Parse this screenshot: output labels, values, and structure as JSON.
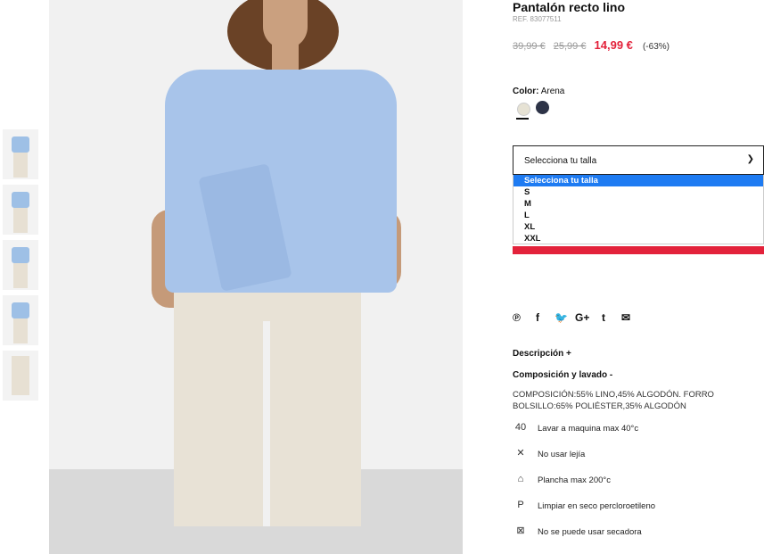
{
  "product": {
    "title": "Pantalón recto lino",
    "ref": "REF. 83077511",
    "price_old_1": "39,99 €",
    "price_old_2": "25,99 €",
    "price_new": "14,99 €",
    "discount": "(-63%)"
  },
  "color": {
    "label": "Color:",
    "value": "Arena",
    "swatches": [
      "#e6e2d4",
      "#2d3347"
    ]
  },
  "size_select": {
    "placeholder": "Selecciona tu talla",
    "options": [
      "Selecciona tu talla",
      "S",
      "M",
      "L",
      "XL",
      "XXL"
    ]
  },
  "social_icons": [
    "pinterest-icon",
    "facebook-icon",
    "twitter-icon",
    "google-plus-icon",
    "tumblr-icon",
    "email-icon"
  ],
  "social_glyphs": [
    "℗",
    "f",
    "🐦",
    "G+",
    "t",
    "✉"
  ],
  "sections": {
    "description": "Descripción +",
    "composition": "Composición y lavado -"
  },
  "composition_text": "COMPOSICIÓN:55% LINO,45% ALGODÓN. FORRO BOLSILLO:65% POLIÉSTER,35% ALGODÓN",
  "care": [
    {
      "icon": "wash-40-icon",
      "glyph": "40",
      "text": "Lavar a maquina max 40°c"
    },
    {
      "icon": "no-bleach-icon",
      "glyph": "✕",
      "text": "No usar lejía"
    },
    {
      "icon": "iron-icon",
      "glyph": "⌂",
      "text": "Plancha max 200°c"
    },
    {
      "icon": "dry-clean-p-icon",
      "glyph": "P",
      "text": "Limpiar en seco percloroetileno"
    },
    {
      "icon": "no-tumble-dry-icon",
      "glyph": "⊠",
      "text": "No se puede usar secadora"
    }
  ]
}
